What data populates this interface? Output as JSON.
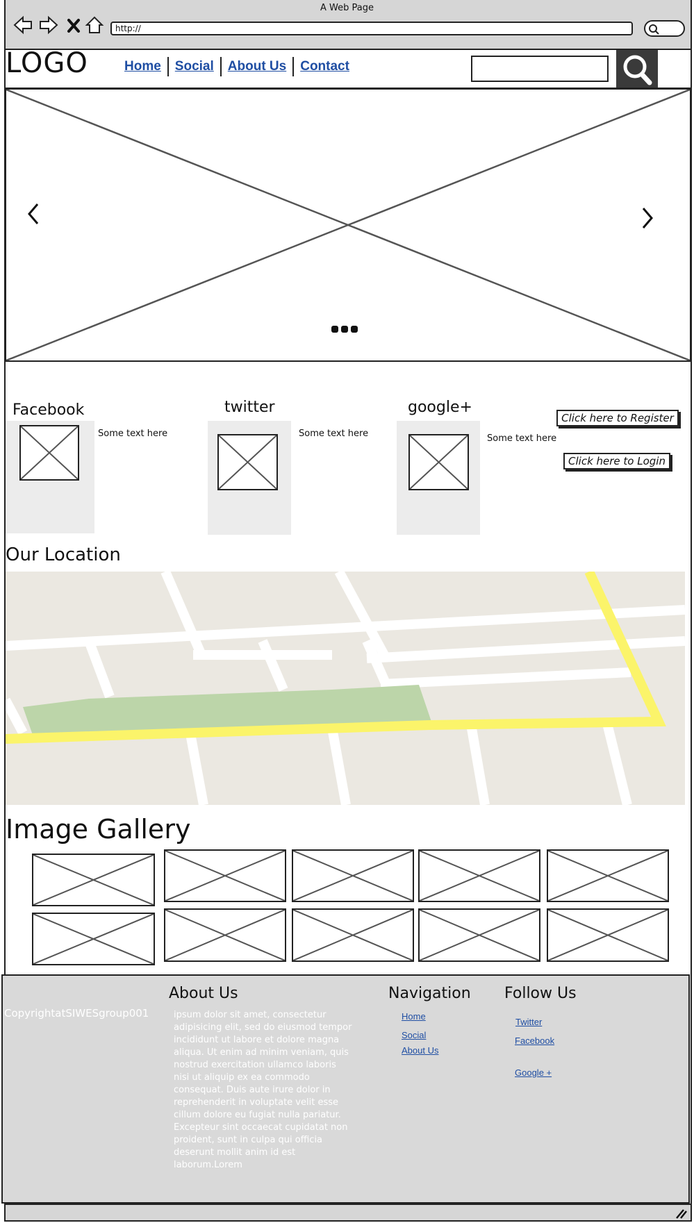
{
  "browser": {
    "title": "A Web Page",
    "url": "http://"
  },
  "header": {
    "logo": "LOGO",
    "nav": [
      "Home",
      "Social",
      "About Us",
      "Contact"
    ]
  },
  "social": {
    "cards": [
      {
        "title": "Facebook",
        "text": "Some text here"
      },
      {
        "title": "twitter",
        "text": "Some text here"
      },
      {
        "title": "google+",
        "text": "Some text here"
      }
    ],
    "register_label": "Click here to Register",
    "login_label": "Click here to Login"
  },
  "location": {
    "title": "Our Location"
  },
  "gallery": {
    "title": "Image Gallery",
    "image_count": 10
  },
  "footer": {
    "copyright": "CopyrightatSIWESgroup001",
    "about_title": "About Us",
    "about_text": " ipsum dolor sit amet, consectetur adipisicing elit, sed do eiusmod tempor incididunt ut labore et dolore magna aliqua. Ut enim ad minim veniam, quis nostrud exercitation ullamco laboris nisi ut aliquip ex ea commodo consequat. Duis aute irure dolor in reprehenderit in voluptate velit esse cillum dolore eu fugiat nulla pariatur. Excepteur sint occaecat cupidatat non proident, sunt in culpa qui officia deserunt mollit anim id est laborum.Lorem",
    "nav_title": "Navigation",
    "nav_links": [
      "Home",
      "Social",
      "About Us"
    ],
    "follow_title": "Follow Us",
    "follow_links": [
      "Twitter",
      "Facebook",
      "Google +"
    ]
  },
  "colors": {
    "chrome": "#d6d6d6",
    "link": "#1f4ea3",
    "footer_bg": "#d9d9d9",
    "map_base": "#ebe8e1",
    "map_park": "#bcd5a9",
    "map_road_major": "#fbf46a"
  },
  "icons": [
    "back-arrow-icon",
    "forward-arrow-icon",
    "stop-icon",
    "home-icon",
    "search-icon",
    "chevron-left-icon",
    "chevron-right-icon",
    "resize-grip-icon"
  ]
}
